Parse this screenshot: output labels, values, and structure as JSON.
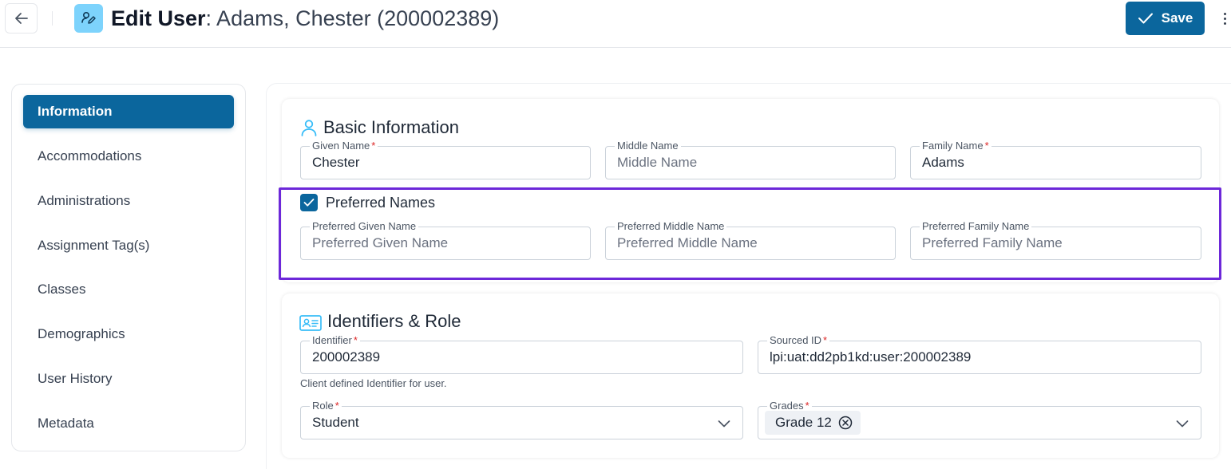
{
  "header": {
    "title_bold": "Edit User",
    "title_rest": ": Adams, Chester (200002389)",
    "save_label": "Save",
    "icons": {
      "back": "arrow-left-icon",
      "edit": "user-edit-icon",
      "save": "check-icon",
      "more": "kebab-menu-icon"
    }
  },
  "sidebar": {
    "items": [
      {
        "label": "Information",
        "active": true
      },
      {
        "label": "Accommodations",
        "active": false
      },
      {
        "label": "Administrations",
        "active": false
      },
      {
        "label": "Assignment Tag(s)",
        "active": false
      },
      {
        "label": "Classes",
        "active": false
      },
      {
        "label": "Demographics",
        "active": false
      },
      {
        "label": "User History",
        "active": false
      },
      {
        "label": "Metadata",
        "active": false
      }
    ]
  },
  "basic_info": {
    "title": "Basic Information",
    "icon": "user-outline-icon",
    "given_name": {
      "label": "Given Name",
      "value": "Chester",
      "required": true
    },
    "middle_name": {
      "label": "Middle Name",
      "placeholder": "Middle Name",
      "required": false
    },
    "family_name": {
      "label": "Family Name",
      "value": "Adams",
      "required": true
    },
    "preferred_names": {
      "label": "Preferred Names",
      "checked": true,
      "given": {
        "label": "Preferred Given Name",
        "placeholder": "Preferred Given Name"
      },
      "middle": {
        "label": "Preferred Middle Name",
        "placeholder": "Preferred Middle Name"
      },
      "family": {
        "label": "Preferred Family Name",
        "placeholder": "Preferred Family Name"
      }
    }
  },
  "identifiers": {
    "title": "Identifiers & Role",
    "icon": "id-card-icon",
    "identifier": {
      "label": "Identifier",
      "value": "200002389",
      "helper": "Client defined Identifier for user.",
      "required": true
    },
    "sourced_id": {
      "label": "Sourced ID",
      "value": "lpi:uat:dd2pb1kd:user:200002389",
      "required": true
    },
    "role": {
      "label": "Role",
      "value": "Student",
      "required": true
    },
    "grades": {
      "label": "Grades",
      "chips": [
        "Grade 12"
      ],
      "required": true
    }
  },
  "colors": {
    "primary": "#0b669d",
    "highlight": "#6d28d9",
    "required": "#dc2626",
    "icon_accent": "#38bdf8"
  }
}
